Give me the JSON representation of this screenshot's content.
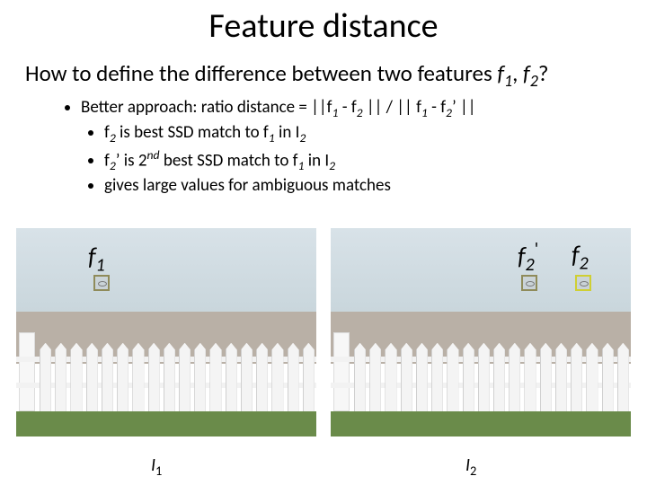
{
  "title": "Feature distance",
  "question_prefix": "How to define the difference between two features ",
  "question_f1": "f",
  "question_f1_sub": "1",
  "question_mid": ", ",
  "question_f2": "f",
  "question_f2_sub": "2",
  "question_suffix": "?",
  "bullets": {
    "main_prefix": "Better approach:  ratio distance = ||f",
    "main_s1": "1",
    "main_mid1": " - f",
    "main_s2": "2",
    "main_mid2": " || / || f",
    "main_s3": "1",
    "main_mid3": " - f",
    "main_s4": "2",
    "main_prime": "’ ||",
    "sub1_a": "f",
    "sub1_a_sub": "2",
    "sub1_b": " is best SSD match to f",
    "sub1_b_sub": "1",
    "sub1_c": " in I",
    "sub1_c_sub": "2",
    "sub2_a": "f",
    "sub2_a_sub": "2",
    "sub2_b": "’  is  2",
    "sub2_sup": "nd",
    "sub2_c": " best SSD match to f",
    "sub2_c_sub": "1",
    "sub2_d": " in I",
    "sub2_d_sub": "2",
    "sub3": "gives large values for ambiguous matches"
  },
  "fig1": {
    "label_f": "f",
    "label_f_sub": "1",
    "caption_i": "I",
    "caption_i_sub": "1"
  },
  "fig2": {
    "label_f2p": "f",
    "label_f2p_sub": "2",
    "label_f2p_prime": "'",
    "label_f2": "f",
    "label_f2_sub": "2",
    "caption_i": "I",
    "caption_i_sub": "2"
  }
}
